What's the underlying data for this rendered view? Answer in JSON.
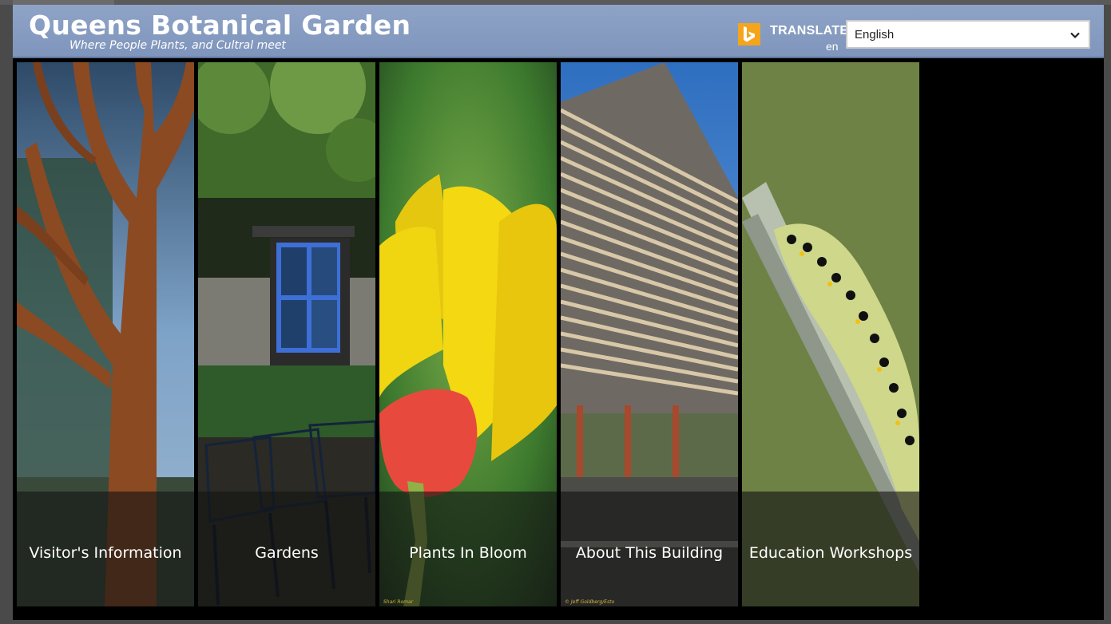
{
  "header": {
    "title": "Queens Botanical Garden",
    "subtitle": "Where People Plants, and Cultral meet"
  },
  "translator": {
    "label": "TRANSLATE",
    "lang_code": "en",
    "selected_language": "English",
    "logo_icon": "bing-logo-icon",
    "dropdown_icon": "chevron-down-icon"
  },
  "tiles": [
    {
      "label": "Visitor's Information",
      "credit": "",
      "image": "rusted-metal-tree-sculpture"
    },
    {
      "label": "Gardens",
      "credit": "",
      "image": "garden-benches-blue-window"
    },
    {
      "label": "Plants In Bloom",
      "credit": "Shari Romar",
      "image": "yellow-red-tulip"
    },
    {
      "label": "About This Building",
      "credit": "© Jeff Goldberg/Esto",
      "image": "building-with-wood-louvers"
    },
    {
      "label": "Education Workshops",
      "credit": "",
      "image": "swallowtail-caterpillar-on-stem"
    }
  ],
  "colors": {
    "header_bg": "#8297bd",
    "accent_bing": "#f4a51c",
    "app_bg": "#000000"
  }
}
